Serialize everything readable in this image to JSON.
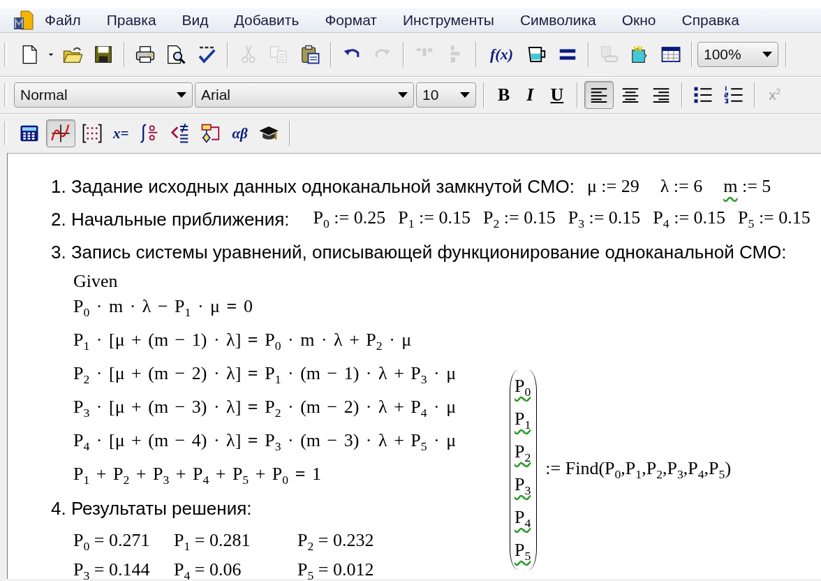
{
  "menu": [
    "Файл",
    "Правка",
    "Вид",
    "Добавить",
    "Формат",
    "Инструменты",
    "Символика",
    "Окно",
    "Справка"
  ],
  "toolbars": [
    {
      "items": [
        {
          "kind": "new",
          "disabled": false
        },
        {
          "kind": "caret",
          "disabled": false
        },
        {
          "kind": "open",
          "disabled": false
        },
        {
          "kind": "save",
          "disabled": false
        },
        {
          "kind": "sep"
        },
        {
          "kind": "print",
          "disabled": false
        },
        {
          "kind": "preview",
          "disabled": false
        },
        {
          "kind": "spell",
          "disabled": false
        },
        {
          "kind": "sep"
        },
        {
          "kind": "cut",
          "disabled": true
        },
        {
          "kind": "copy",
          "disabled": true
        },
        {
          "kind": "paste",
          "disabled": false
        },
        {
          "kind": "sep"
        },
        {
          "kind": "undo",
          "disabled": false
        },
        {
          "kind": "redo",
          "disabled": true
        },
        {
          "kind": "sep"
        },
        {
          "kind": "align-top",
          "disabled": true
        },
        {
          "kind": "align-side",
          "disabled": true
        },
        {
          "kind": "sep"
        },
        {
          "kind": "function",
          "label": "f(x)",
          "disabled": false
        },
        {
          "kind": "cup",
          "disabled": false
        },
        {
          "kind": "equals",
          "disabled": false
        },
        {
          "kind": "sep"
        },
        {
          "kind": "link",
          "disabled": true
        },
        {
          "kind": "puzzle",
          "disabled": false
        },
        {
          "kind": "table",
          "disabled": false
        },
        {
          "kind": "sep"
        },
        {
          "kind": "zoom-dropdown",
          "value": "100%"
        },
        {
          "kind": "sep"
        }
      ]
    },
    {
      "items": [
        {
          "kind": "style-dropdown",
          "value": "Normal"
        },
        {
          "kind": "font-dropdown",
          "value": "Arial"
        },
        {
          "kind": "size-dropdown",
          "value": "10"
        },
        {
          "kind": "sep"
        },
        {
          "kind": "bold",
          "label": "B",
          "pressed": false
        },
        {
          "kind": "italic",
          "label": "I",
          "pressed": false
        },
        {
          "kind": "underline",
          "label": "U",
          "pressed": false
        },
        {
          "kind": "sep"
        },
        {
          "kind": "align-left",
          "pressed": true
        },
        {
          "kind": "align-center",
          "pressed": false
        },
        {
          "kind": "align-right",
          "pressed": false
        },
        {
          "kind": "sep"
        },
        {
          "kind": "bullets",
          "pressed": false
        },
        {
          "kind": "numbered",
          "pressed": false
        },
        {
          "kind": "sep"
        },
        {
          "kind": "superscript",
          "label": "x$^{2}$",
          "disabled": true
        }
      ]
    },
    {
      "items": [
        {
          "kind": "calculator",
          "pressed": false
        },
        {
          "kind": "graph",
          "pressed": true
        },
        {
          "kind": "matrix",
          "pressed": false
        },
        {
          "kind": "evaluation",
          "label": "x=",
          "pressed": false
        },
        {
          "kind": "calculus",
          "pressed": false
        },
        {
          "kind": "boolean",
          "pressed": false
        },
        {
          "kind": "programming",
          "pressed": false
        },
        {
          "kind": "greek",
          "label": "αβ",
          "pressed": false
        },
        {
          "kind": "symbolic",
          "pressed": false
        },
        {
          "kind": "sep"
        }
      ]
    }
  ],
  "sections": [
    {
      "heading": "1. Задание исходных данных одноканальной замкнутой СМО:",
      "definitions": [
        {
          "name": "μ",
          "op": ":=",
          "value": "29",
          "flagged": false
        },
        {
          "name": "λ",
          "op": ":=",
          "value": "6",
          "flagged": false
        },
        {
          "name": "m",
          "op": ":=",
          "value": "5",
          "flagged": true
        }
      ]
    },
    {
      "heading": "2. Начальные приближения:",
      "definitions": [
        {
          "name": "P$_{0}$",
          "op": ":=",
          "value": "0.25",
          "flagged": false
        },
        {
          "name": "P$_{1}$",
          "op": ":=",
          "value": "0.15",
          "flagged": false
        },
        {
          "name": "P$_{2}$",
          "op": ":=",
          "value": "0.15",
          "flagged": false
        },
        {
          "name": "P$_{3}$",
          "op": ":=",
          "value": "0.15",
          "flagged": false
        },
        {
          "name": "P$_{4}$",
          "op": ":=",
          "value": "0.15",
          "flagged": false
        },
        {
          "name": "P$_{5}$",
          "op": ":=",
          "value": "0.15",
          "flagged": false
        }
      ]
    },
    {
      "heading": "3. Запись системы уравнений, описывающей функционирование одноканальной СМО:",
      "keyword": "Given",
      "equations": [
        "P$_{0}$ · m · λ − P$_{1}$ · μ **=** 0",
        "P$_{1}$ · [μ + (m − 1) · λ] **=** P$_{0}$ · m · λ + P$_{2}$ · μ",
        "P$_{2}$ · [μ + (m − 2) · λ] **=** P$_{1}$ · (m − 1) · λ + P$_{3}$ · μ",
        "P$_{3}$ · [μ + (m − 3) · λ] **=** P$_{2}$ · (m − 2) · λ + P$_{4}$ · μ",
        "P$_{4}$ · [μ + (m − 4) · λ] **=** P$_{3}$ · (m − 3) · λ + P$_{5}$ · μ",
        "P$_{1}$ + P$_{2}$ + P$_{3}$ + P$_{4}$ + P$_{5}$ + P$_{0}$ **=** 1"
      ],
      "solve": {
        "vector": [
          {
            "name": "P$_{0}$",
            "flagged": true
          },
          {
            "name": "P$_{1}$",
            "flagged": true
          },
          {
            "name": "P$_{2}$",
            "flagged": true
          },
          {
            "name": "P$_{3}$",
            "flagged": true
          },
          {
            "name": "P$_{4}$",
            "flagged": true
          },
          {
            "name": "P$_{5}$",
            "flagged": true
          }
        ],
        "expression": ":= Find(P$_{0}$,P$_{1}$,P$_{2}$,P$_{3}$,P$_{4}$,P$_{5}$)"
      }
    },
    {
      "heading": "4. Результаты решения:",
      "results": [
        [
          "P$_{0}$ = 0.271",
          "P$_{1}$ = 0.281",
          "P$_{2}$ = 0.232"
        ],
        [
          "P$_{3}$ = 0.144",
          "P$_{4}$ = 0.06",
          "P$_{5}$ = 0.012"
        ]
      ]
    }
  ]
}
